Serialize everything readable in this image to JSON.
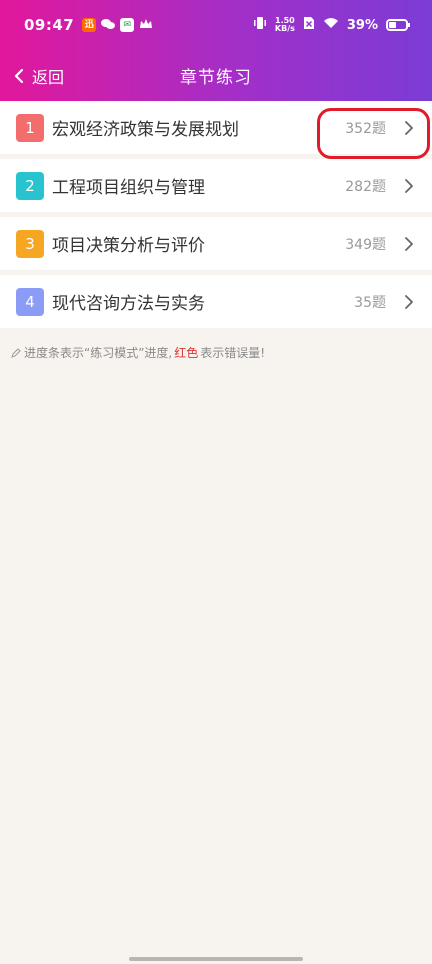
{
  "status": {
    "time": "09:47",
    "speed_top": "1.50",
    "speed_unit": "KB/s",
    "battery": "39%"
  },
  "nav": {
    "back_label": "返回",
    "title": "章节练习"
  },
  "chapters": [
    {
      "num": "1",
      "title": "宏观经济政策与发展规划",
      "count": "352题",
      "color": "#f36d6d"
    },
    {
      "num": "2",
      "title": "工程项目组织与管理",
      "count": "282题",
      "color": "#27c3cf"
    },
    {
      "num": "3",
      "title": "项目决策分析与评价",
      "count": "349题",
      "color": "#f5a623"
    },
    {
      "num": "4",
      "title": "现代咨询方法与实务",
      "count": "35题",
      "color": "#8a9cf5"
    }
  ],
  "tip": {
    "prefix": "进度条表示“练习模式”进度,",
    "red_word": "红色",
    "suffix": "表示错误量!"
  }
}
